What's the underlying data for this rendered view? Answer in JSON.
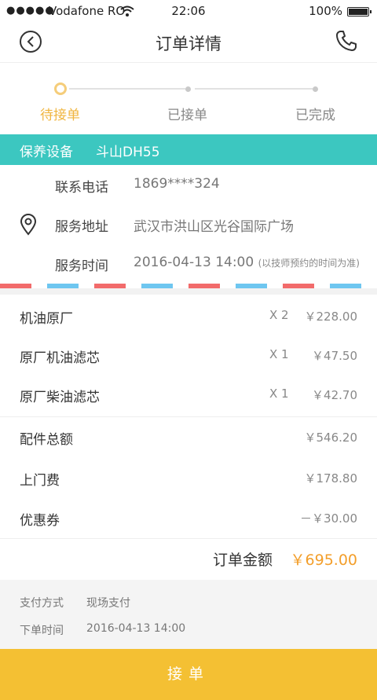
{
  "status_bar": {
    "signal": "●●●●●",
    "carrier": "Vodafone RO",
    "time": "22:06",
    "battery": "100%"
  },
  "nav": {
    "title": "订单详情",
    "back_icon": "back-circle-icon",
    "phone_icon": "phone-icon"
  },
  "progress": {
    "steps": [
      {
        "label": "待接单",
        "active": true
      },
      {
        "label": "已接单",
        "active": false
      },
      {
        "label": "已完成",
        "active": false
      }
    ],
    "active_color": "#f0b53f"
  },
  "device": {
    "label": "保养设备",
    "value": "斗山DH55",
    "color": "#3cc7c0"
  },
  "contact": {
    "phone_label": "联系电话",
    "phone_value": "1869****324",
    "address_label": "服务地址",
    "address_value": "武汉市洪山区光谷国际广场",
    "time_label": "服务时间",
    "time_value": "2016-04-13 14:00",
    "time_note": "(以技师预约的时间为准)"
  },
  "items": [
    {
      "name": "机油原厂",
      "qty": "X 2",
      "price": "￥228.00"
    },
    {
      "name": "原厂机油滤芯",
      "qty": "X 1",
      "price": "￥47.50"
    },
    {
      "name": "原厂柴油滤芯",
      "qty": "X 1",
      "price": "￥42.70"
    }
  ],
  "fees": [
    {
      "name": "配件总额",
      "price": "￥546.20"
    },
    {
      "name": "上门费",
      "price": "￥178.80"
    },
    {
      "name": "优惠券",
      "price": "－￥30.00"
    }
  ],
  "total": {
    "label": "订单金额",
    "value": "￥695.00",
    "color": "#f39e2a"
  },
  "payment": {
    "method_label": "支付方式",
    "method_value": "现场支付",
    "order_time_label": "下单时间",
    "order_time_value": "2016-04-13 14:00"
  },
  "action": {
    "accept_label": "接单",
    "color": "#f4c033"
  }
}
